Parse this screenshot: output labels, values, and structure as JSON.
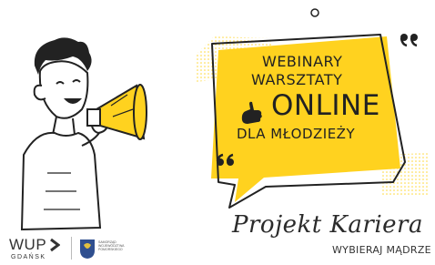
{
  "bubble": {
    "line1": "WEBINARY",
    "line2": "WARSZTATY",
    "line3": "ONLINE",
    "line4": "DLA MŁODZIEŻY"
  },
  "brand": {
    "name": "Projekt Kariera",
    "tagline": "WYBIERAJ MĄDRZE"
  },
  "logos": {
    "wup": "WUP",
    "wup_city": "GDAŃSK",
    "crest_caption": "SAMORZĄD WOJEWÓDZTWA POMORSKIEGO"
  },
  "colors": {
    "accent_yellow": "#FFD21F",
    "ink": "#222222"
  },
  "icons": [
    "pointing-hand-icon",
    "quote-icon",
    "megaphone-icon",
    "crest-icon"
  ]
}
